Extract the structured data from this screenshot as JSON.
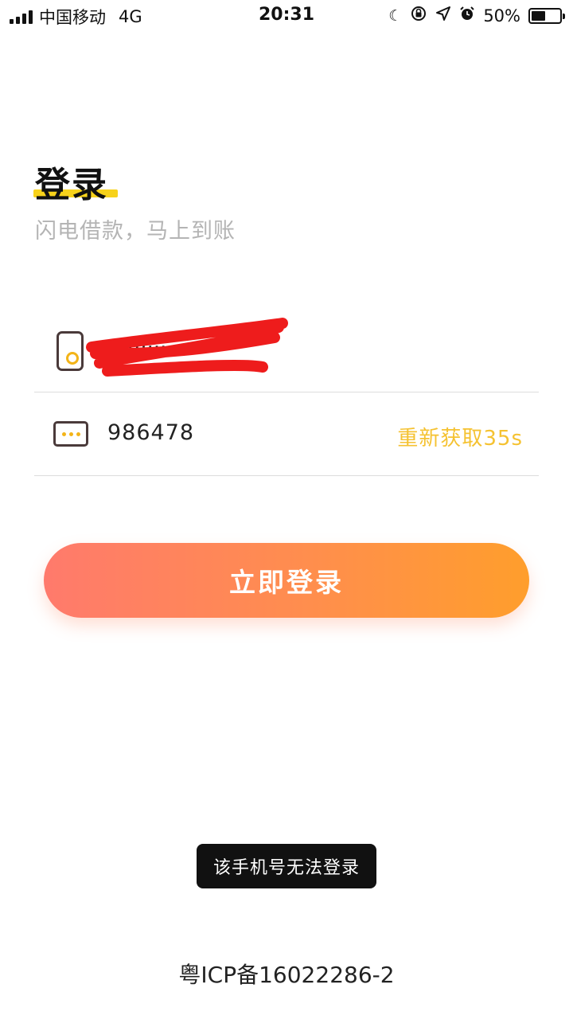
{
  "status_bar": {
    "carrier": "中国移动",
    "network": "4G",
    "time": "20:31",
    "battery_percent": "50%",
    "battery_level": 0.5,
    "icons": [
      "moon-icon",
      "rotation-lock-icon",
      "location-icon",
      "alarm-icon"
    ]
  },
  "header": {
    "title": "登录",
    "subtitle": "闪电借款，马上到账",
    "accent_color": "#f7d21b"
  },
  "form": {
    "phone": {
      "icon": "phone-icon",
      "value": "13·········",
      "redacted": true
    },
    "code": {
      "icon": "sms-code-icon",
      "value": "986478",
      "resend_label": "重新获取35s",
      "resend_color": "#f5c231"
    }
  },
  "login_button": {
    "label": "立即登录",
    "gradient": [
      "#ff7a6c",
      "#ff9e2c"
    ]
  },
  "toast": {
    "message": "该手机号无法登录"
  },
  "footer": {
    "icp": "粤ICP备16022286-2"
  }
}
